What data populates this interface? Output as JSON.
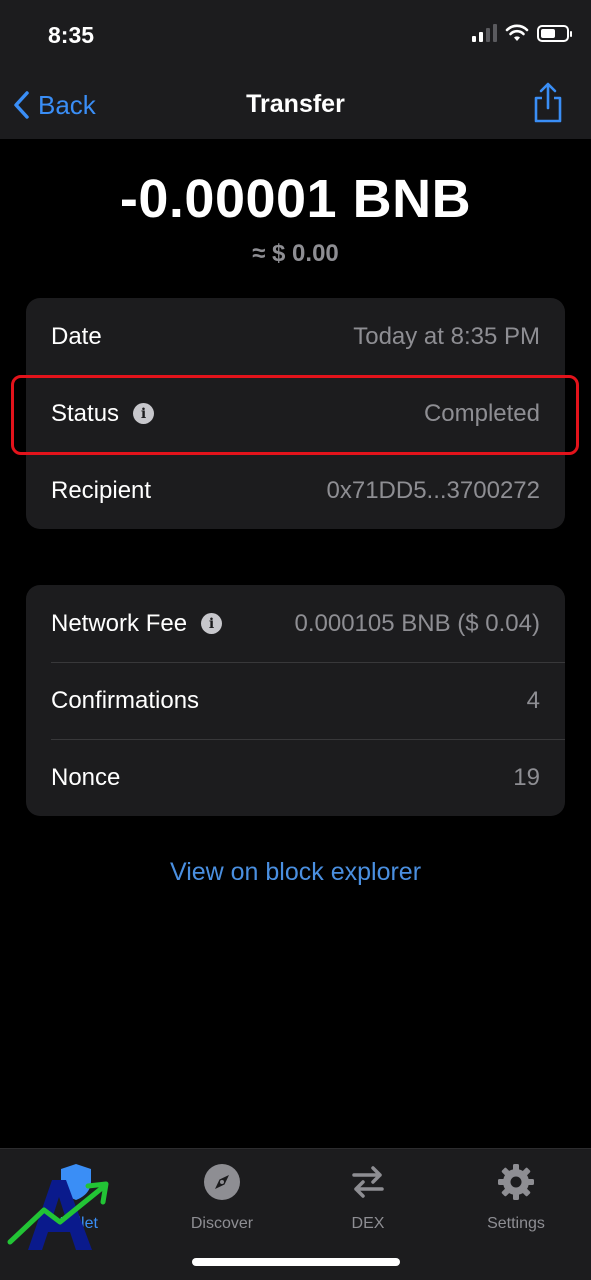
{
  "status_bar": {
    "time": "8:35"
  },
  "nav": {
    "back_label": "Back",
    "title": "Transfer"
  },
  "transaction": {
    "amount": "-0.00001 BNB",
    "fiat_value": "≈ $ 0.00"
  },
  "details": [
    {
      "label": "Date",
      "value": "Today at 8:35 PM"
    },
    {
      "label": "Status",
      "value": "Completed",
      "info": true
    },
    {
      "label": "Recipient",
      "value": "0x71DD5...3700272"
    }
  ],
  "network": [
    {
      "label": "Network Fee",
      "value": "0.000105 BNB ($ 0.04)",
      "info": true
    },
    {
      "label": "Confirmations",
      "value": "4"
    },
    {
      "label": "Nonce",
      "value": "19"
    }
  ],
  "explorer_link": "View on block explorer",
  "tabs": [
    {
      "label": "Wallet",
      "icon": "shield-icon",
      "active": true
    },
    {
      "label": "Discover",
      "icon": "compass-icon"
    },
    {
      "label": "DEX",
      "icon": "swap-arrows-icon"
    },
    {
      "label": "Settings",
      "icon": "gear-icon"
    }
  ],
  "colors": {
    "background": "#000000",
    "surface": "#1c1c1e",
    "accent": "#3a8ef6",
    "secondary_text": "#8e8e93",
    "highlight": "#e3131b"
  }
}
